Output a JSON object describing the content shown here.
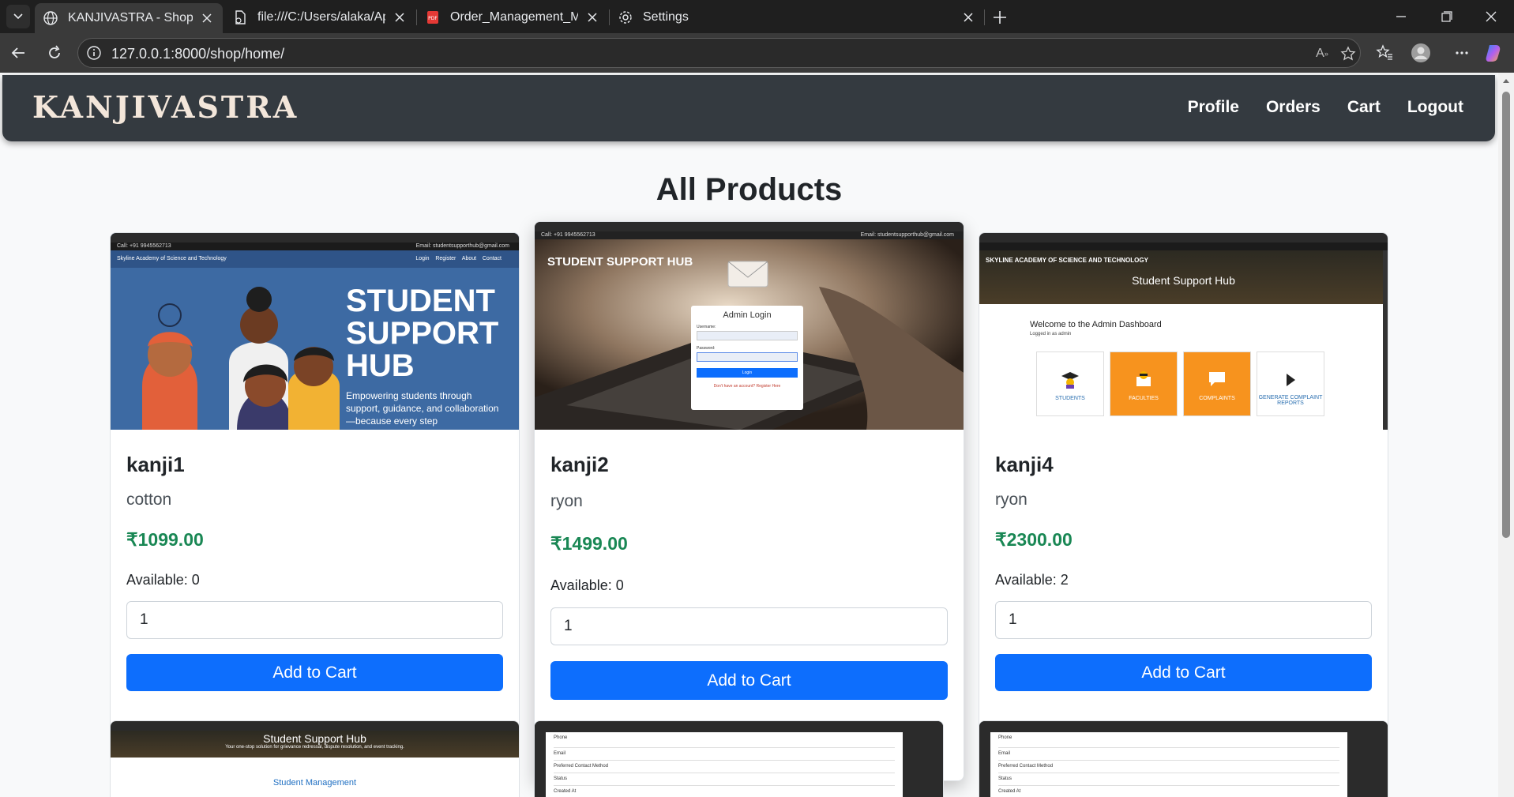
{
  "browser": {
    "tabs": [
      {
        "title": "KANJIVASTRA - Shop",
        "icon": "globe-icon",
        "active": true
      },
      {
        "title": "file:///C:/Users/alaka/AppData/Lo",
        "icon": "file-icon",
        "active": false
      },
      {
        "title": "Order_Management_Machine_Tes",
        "icon": "pdf-icon",
        "active": false
      },
      {
        "title": "Settings",
        "icon": "gear-icon",
        "active": false
      }
    ],
    "url": "127.0.0.1:8000/shop/home/"
  },
  "navbar": {
    "brand": "KANJIVASTRA",
    "links": [
      "Profile",
      "Orders",
      "Cart",
      "Logout"
    ]
  },
  "page": {
    "heading": "All Products"
  },
  "products": [
    {
      "name": "kanji1",
      "material": "cotton",
      "price": "₹1099.00",
      "available": "Available: 0",
      "quantity": "1",
      "button": "Add to Cart",
      "thumb": {
        "topbar_left": "Call: +91 9945562713",
        "topbar_right": "Email: studentsupporthub@gmail.com",
        "site": "Skyline Academy of Science and Technology",
        "nav": [
          "Login",
          "Register",
          "About",
          "Contact"
        ],
        "hero_title": [
          "STUDENT",
          "SUPPORT",
          "HUB"
        ],
        "hero_text": "Empowering students through support, guidance, and collaboration—because every step"
      }
    },
    {
      "name": "kanji2",
      "material": "ryon",
      "price": "₹1499.00",
      "available": "Available: 0",
      "quantity": "1",
      "button": "Add to Cart",
      "thumb": {
        "topbar_left": "Call: +91 9945562713",
        "topbar_right": "Email: studentsupporthub@gmail.com",
        "site": "STUDENT SUPPORT HUB",
        "login_title": "Admin Login",
        "login_user_label": "Username:",
        "login_pass_label": "Password:",
        "login_button": "Login",
        "login_footer": "Don't have an account? Register Here"
      }
    },
    {
      "name": "kanji4",
      "material": "ryon",
      "price": "₹2300.00",
      "available": "Available: 2",
      "quantity": "1",
      "button": "Add to Cart",
      "thumb": {
        "site": "SKYLINE ACADEMY OF SCIENCE AND TECHNOLOGY",
        "hub": "Student Support Hub",
        "welcome": "Welcome to the Admin Dashboard",
        "logged": "Logged in as admin",
        "tiles": [
          "STUDENTS",
          "FACULTIES",
          "COMPLAINTS",
          "GENERATE COMPLAINT REPORTS"
        ]
      }
    }
  ],
  "second_row": [
    {
      "thumb_title": "Student Support Hub",
      "thumb_sub": "Your one-stop solution for grievance redressal, dispute resolution, and event tracking.",
      "thumb_link": "Student Management"
    },
    {
      "rows": [
        "Phone",
        "Email",
        "Preferred Contact Method",
        "Status",
        "Created At"
      ]
    },
    {
      "rows": [
        "Phone",
        "Email",
        "Preferred Contact Method",
        "Status",
        "Created At"
      ]
    }
  ],
  "colors": {
    "navbar_bg": "#343a40",
    "brand": "#f3e6da",
    "price": "#198754",
    "button": "#0d6efd",
    "page_bg": "#f8f9fa"
  }
}
